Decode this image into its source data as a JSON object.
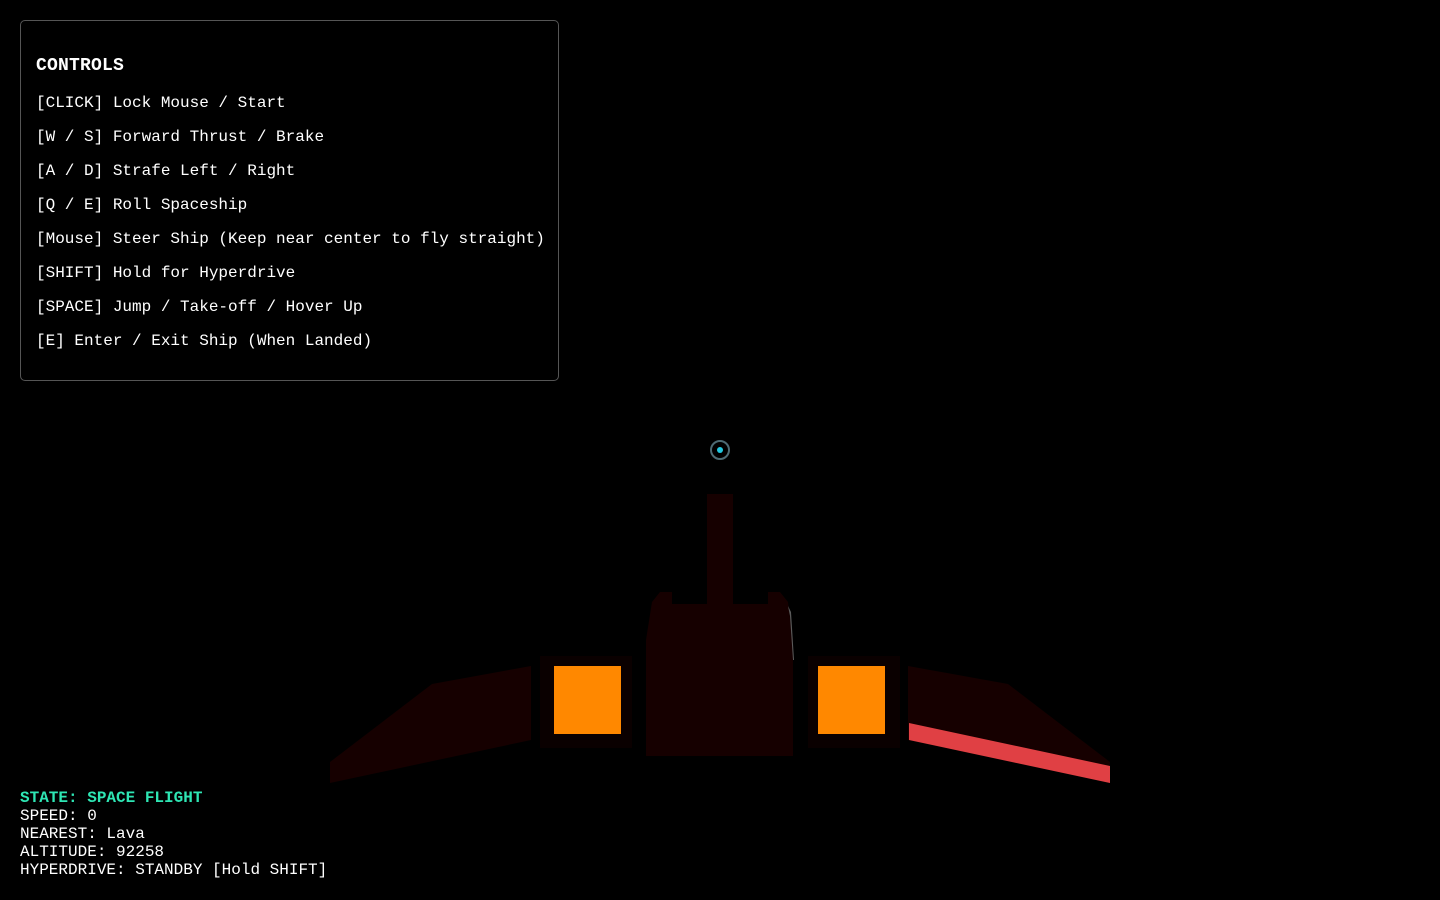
{
  "controls": {
    "title": "CONTROLS",
    "items": [
      "[CLICK] Lock Mouse / Start",
      "[W / S] Forward Thrust / Brake",
      "[A / D] Strafe Left / Right",
      "[Q / E] Roll Spaceship",
      "[Mouse] Steer Ship (Keep near center to fly straight)",
      "[SHIFT] Hold for Hyperdrive",
      "[SPACE] Jump / Take-off / Hover Up",
      "[E] Enter / Exit Ship (When Landed)"
    ]
  },
  "hud": {
    "state": "STATE: SPACE FLIGHT",
    "speed": "SPEED: 0",
    "nearest": "NEAREST: Lava",
    "altitude": "ALTITUDE: 92258",
    "hyperdrive": "HYPERDRIVE: STANDBY [Hold SHIFT]"
  },
  "colors": {
    "hull": "#160000",
    "engine": "#ff8800",
    "wing_stripe": "#e04044",
    "state_text": "#2ee6b4",
    "crosshair_dot": "#22c8e0"
  },
  "icons": {
    "crosshair": "crosshair-icon"
  }
}
